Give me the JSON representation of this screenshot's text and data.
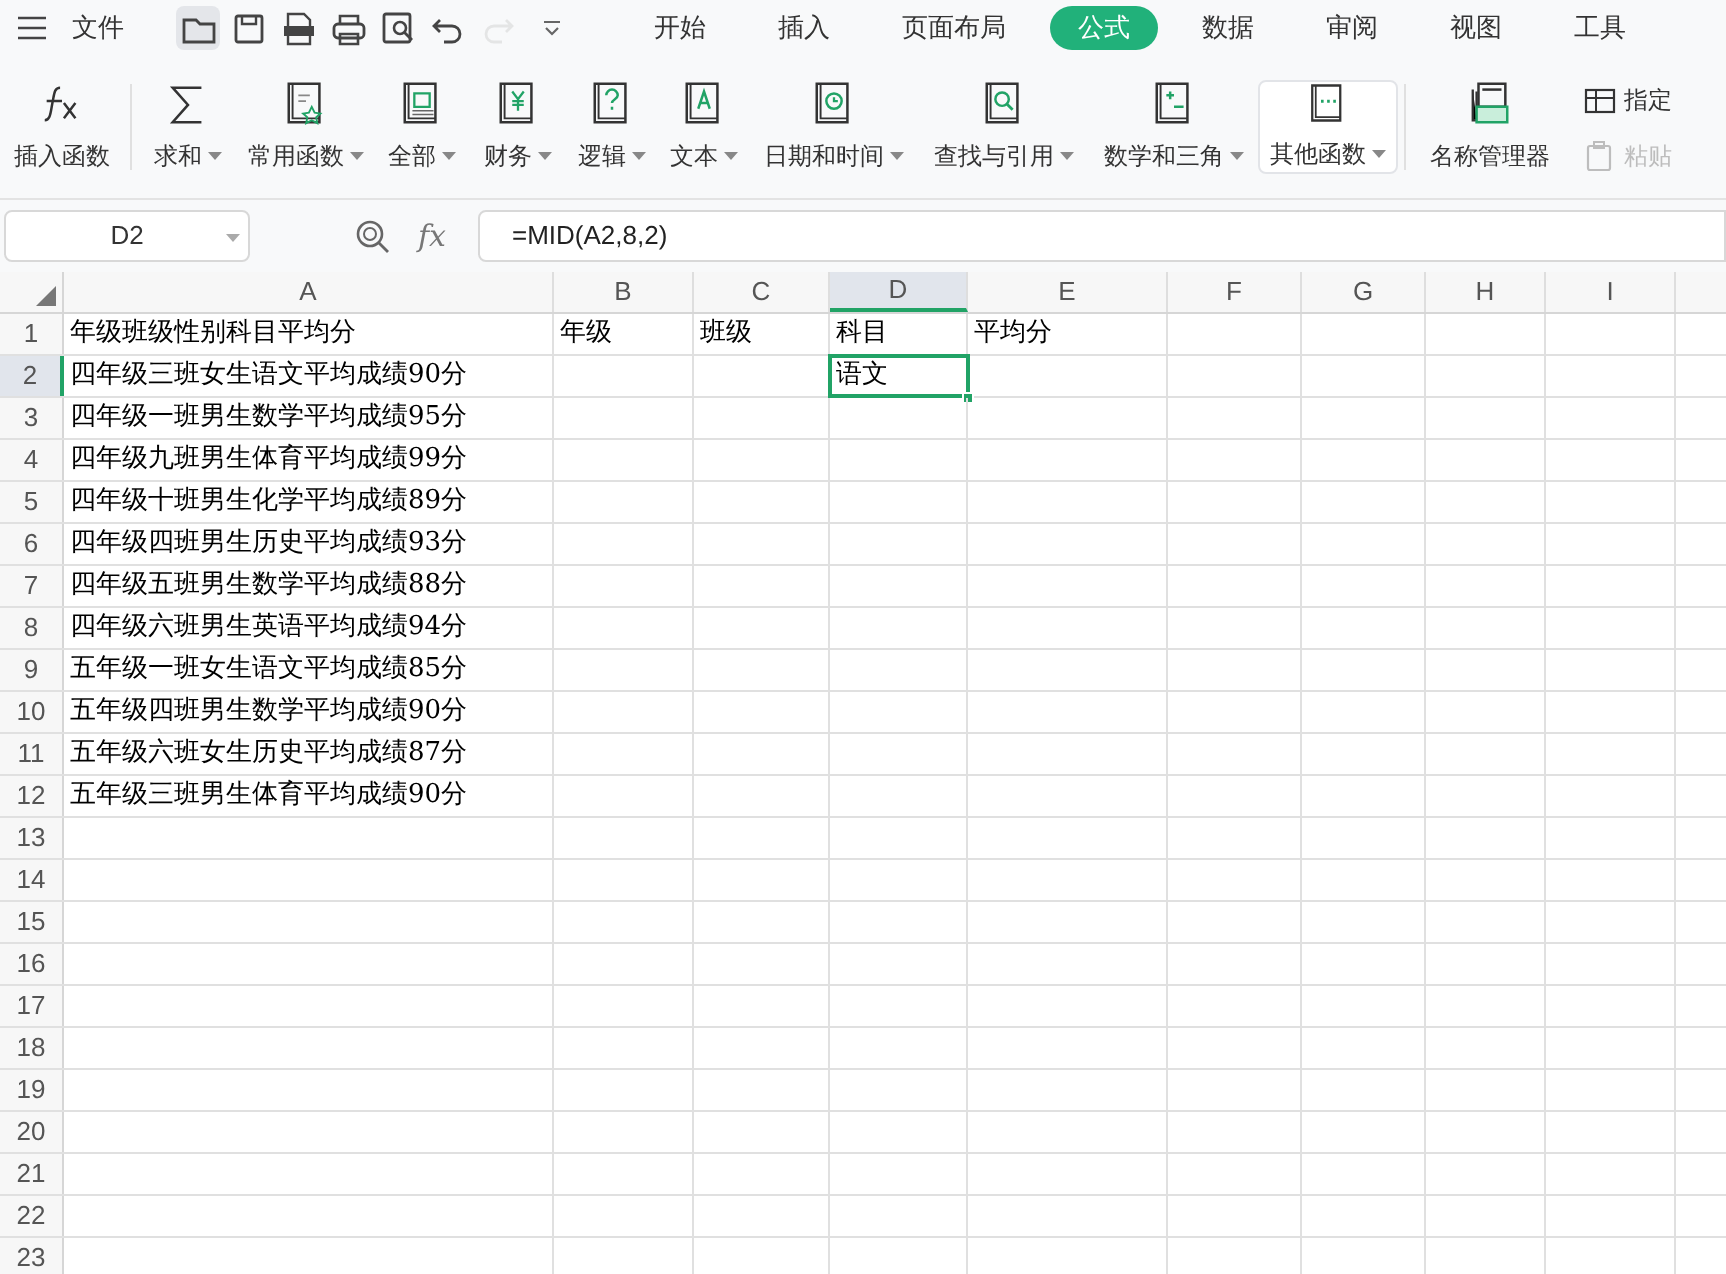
{
  "menu": {
    "file": "文件",
    "quick_access": [
      {
        "disabled": false
      },
      {
        "disabled": false
      },
      {
        "disabled": false
      },
      {
        "disabled": false
      },
      {
        "disabled": false
      },
      {
        "disabled": false
      },
      {
        "disabled": true
      }
    ],
    "tabs": [
      {
        "label": "开始",
        "selected": false
      },
      {
        "label": "插入",
        "selected": false
      },
      {
        "label": "页面布局",
        "selected": false
      },
      {
        "label": "公式",
        "selected": true
      },
      {
        "label": "数据",
        "selected": false
      },
      {
        "label": "审阅",
        "selected": false
      },
      {
        "label": "视图",
        "selected": false
      },
      {
        "label": "工具",
        "selected": false
      }
    ]
  },
  "ribbon": {
    "items": [
      {
        "label": "插入函数",
        "dropdown": false
      },
      {
        "label": "求和",
        "dropdown": true
      },
      {
        "label": "常用函数",
        "dropdown": true
      },
      {
        "label": "全部",
        "dropdown": true
      },
      {
        "label": "财务",
        "dropdown": true
      },
      {
        "label": "逻辑",
        "dropdown": true
      },
      {
        "label": "文本",
        "dropdown": true
      },
      {
        "label": "日期和时间",
        "dropdown": true
      },
      {
        "label": "查找与引用",
        "dropdown": true
      },
      {
        "label": "数学和三角",
        "dropdown": true
      },
      {
        "label": "其他函数",
        "dropdown": true
      },
      {
        "label": "名称管理器",
        "dropdown": false
      }
    ],
    "small_items": [
      {
        "label": "指定",
        "disabled": false
      },
      {
        "label": "粘贴",
        "disabled": true
      }
    ]
  },
  "formula_bar": {
    "cell_ref": "D2",
    "fx": "fx",
    "formula": "=MID(A2,8,2)"
  },
  "sheet": {
    "columns": [
      {
        "label": "A",
        "selected": false
      },
      {
        "label": "B",
        "selected": false
      },
      {
        "label": "C",
        "selected": false
      },
      {
        "label": "D",
        "selected": true
      },
      {
        "label": "E",
        "selected": false
      },
      {
        "label": "F",
        "selected": false
      },
      {
        "label": "G",
        "selected": false
      },
      {
        "label": "H",
        "selected": false
      },
      {
        "label": "I",
        "selected": false
      }
    ],
    "rows": [
      {
        "label": "1",
        "selected": false,
        "A": "年级班级性别科目平均分",
        "B": "年级",
        "C": "班级",
        "D": "科目",
        "E": "平均分"
      },
      {
        "label": "2",
        "selected": true,
        "A": "四年级三班女生语文平均成绩90分",
        "D": "语文"
      },
      {
        "label": "3",
        "selected": false,
        "A": "四年级一班男生数学平均成绩95分"
      },
      {
        "label": "4",
        "selected": false,
        "A": "四年级九班男生体育平均成绩99分"
      },
      {
        "label": "5",
        "selected": false,
        "A": "四年级十班男生化学平均成绩89分"
      },
      {
        "label": "6",
        "selected": false,
        "A": "四年级四班男生历史平均成绩93分"
      },
      {
        "label": "7",
        "selected": false,
        "A": "四年级五班男生数学平均成绩88分"
      },
      {
        "label": "8",
        "selected": false,
        "A": "四年级六班男生英语平均成绩94分"
      },
      {
        "label": "9",
        "selected": false,
        "A": "五年级一班女生语文平均成绩85分"
      },
      {
        "label": "10",
        "selected": false,
        "A": "五年级四班男生数学平均成绩90分"
      },
      {
        "label": "11",
        "selected": false,
        "A": "五年级六班女生历史平均成绩87分"
      },
      {
        "label": "12",
        "selected": false,
        "A": "五年级三班男生体育平均成绩90分"
      },
      {
        "label": "13",
        "selected": false
      },
      {
        "label": "14",
        "selected": false
      },
      {
        "label": "15",
        "selected": false
      },
      {
        "label": "16",
        "selected": false
      },
      {
        "label": "17",
        "selected": false
      },
      {
        "label": "18",
        "selected": false
      },
      {
        "label": "19",
        "selected": false
      },
      {
        "label": "20",
        "selected": false
      },
      {
        "label": "21",
        "selected": false
      },
      {
        "label": "22",
        "selected": false
      },
      {
        "label": "23",
        "selected": false
      }
    ]
  }
}
